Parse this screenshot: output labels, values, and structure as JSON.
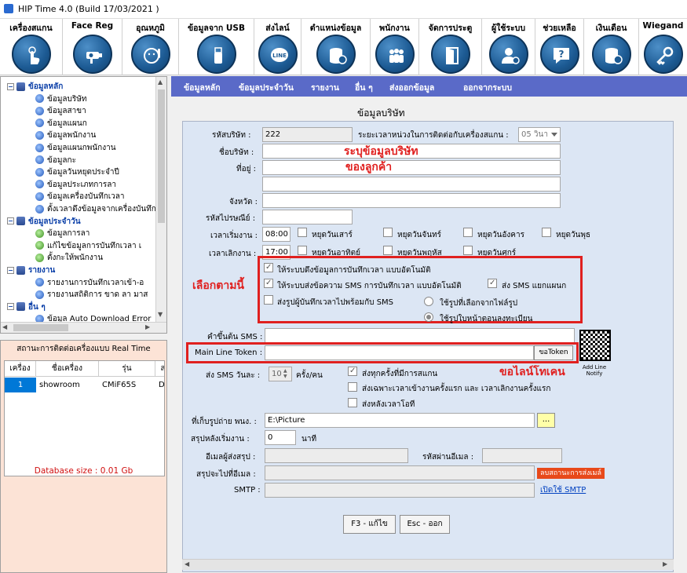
{
  "window": {
    "title": "HIP Time 4.0 (Build 17/03/2021 )"
  },
  "toolbar": [
    {
      "label": "เครื่องสแกน",
      "icon": "touch-icon"
    },
    {
      "label": "Face Reg",
      "icon": "camera-icon"
    },
    {
      "label": "อุณหภูมิ",
      "icon": "temperature-face-icon"
    },
    {
      "label": "ข้อมูลจาก USB",
      "icon": "usb-icon"
    },
    {
      "label": "ส่งไลน์",
      "icon": "line-icon"
    },
    {
      "label": "ตำแหน่งข้อมูล",
      "icon": "database-icon"
    },
    {
      "label": "พนักงาน",
      "icon": "employees-icon"
    },
    {
      "label": "จัดการประตู",
      "icon": "door-icon"
    },
    {
      "label": "ผู้ใช้ระบบ",
      "icon": "user-settings-icon"
    },
    {
      "label": "ช่วยเหลือ",
      "icon": "help-icon"
    },
    {
      "label": "เงินเดือน",
      "icon": "salary-database-icon"
    },
    {
      "label": "Wiegand",
      "icon": "key-icon"
    }
  ],
  "tree": {
    "rows": [
      {
        "label": "ข้อมูลหลัก",
        "group": true,
        "expander": "−"
      },
      {
        "label": "ข้อมูลบริษัท"
      },
      {
        "label": "ข้อมูลสาขา"
      },
      {
        "label": "ข้อมูลแผนก"
      },
      {
        "label": "ข้อมูลพนักงาน"
      },
      {
        "label": "ข้อมูลแผนกพนักงาน"
      },
      {
        "label": "ข้อมูลกะ"
      },
      {
        "label": "ข้อมูลวันหยุดประจำปี"
      },
      {
        "label": "ข้อมูลประเภทการลา"
      },
      {
        "label": "ข้อมูลเครื่องบันทึกเวลา"
      },
      {
        "label": "ตั้งเวลาดึงข้อมูลจากเครื่องบันทึก"
      },
      {
        "label": "ข้อมูลประจำวัน",
        "group": true,
        "expander": "−"
      },
      {
        "label": "ข้อมูลการลา"
      },
      {
        "label": "แก้ไขข้อมูลการบันทึกเวลา เ"
      },
      {
        "label": "ตั้งกะให้พนักงาน"
      },
      {
        "label": "รายงาน",
        "group": true,
        "expander": "−"
      },
      {
        "label": "รายงานการบันทึกเวลาเข้า-อ"
      },
      {
        "label": "รายงานสถิติการ ขาด ลา มาส"
      },
      {
        "label": "อื่น ๆ",
        "group": true,
        "expander": "−"
      },
      {
        "label": "ข้อมูล Auto Download Error"
      }
    ]
  },
  "realtime": {
    "title": "สถานะการติดต่อเครื่องแบบ Real Time",
    "columns": [
      "เครื่อง",
      "ชื่อเครื่อง",
      "รุ่น",
      "ส"
    ],
    "rows": [
      [
        "1",
        "showroom",
        "CMiF65S",
        "Dis"
      ]
    ],
    "db_size": "Database size : 0.01 Gb"
  },
  "menubar": [
    "ข้อมูลหลัก",
    "ข้อมูลประจำวัน",
    "รายงาน",
    "อื่น ๆ",
    "ส่งออกข้อมูล",
    "ออกจากระบบ"
  ],
  "form": {
    "section_title": "ข้อมูลบริษัท",
    "company_code_label": "รหัสบริษัท :",
    "company_code": "222",
    "interval_label": "ระยะเวลาหน่วงในการติดต่อกับเครื่องสแกน :",
    "interval_value": "05 วินา",
    "company_name_label": "ชื่อบริษัท :",
    "address_label": "ที่อยู่ :",
    "province_label": "จังหวัด :",
    "postcode_label": "รหัสไปรษณีย์ :",
    "work_start_label": "เวลาเริ่มงาน :",
    "work_start": "08:00",
    "work_end_label": "เวลาเลิกงาน :",
    "work_end": "17:00",
    "holidays": [
      "หยุดวันเสาร์",
      "หยุดวันจันทร์",
      "หยุดวันอังคาร",
      "หยุดวันพุธ",
      "หยุดวันอาทิตย์",
      "หยุดวันพฤหัส",
      "หยุดวันศุกร์"
    ],
    "opt_auto_pull": "ให้ระบบดึงข้อมูลการบันทึกเวลา แบบอัตโนมัติ",
    "opt_auto_sms": "ให้ระบบส่งข้อความ SMS การบันทึกเวลา แบบอัตโนมัติ",
    "opt_sms_by_dept": "ส่ง SMS แยกแผนก",
    "opt_send_photo": "ส่งรูปผู้บันทึกเวลาไปพร้อมกับ SMS",
    "radio_file_photo": "ใช้รูปที่เลือกจากไฟล์รูป",
    "radio_reg_photo": "ใช้รูปใบหน้าตอนลงทะเบียน",
    "sms_prefix_label": "คำขึ้นต้น SMS :",
    "line_token_label": "Main Line Token :",
    "line_token_button": "ขอToken",
    "add_line_notify": "Add Line Notify",
    "sms_per_day_label": "ส่ง SMS วันละ :",
    "sms_per_day": "10",
    "sms_per_person_suffix": "ครั้ง/คน",
    "sms_every_scan": "ส่งทุกครั้งที่มีการสแกน",
    "sms_first_last": "ส่งเฉพาะเวลาเข้างานครั้งแรก และ เวลาเลิกงานครั้งแรก",
    "sms_after_ot": "ส่งหลังเวลาโอที",
    "photo_store_label": "ที่เก็บรูปถ่าย พนง. :",
    "photo_store": "E:\\Picture",
    "browse_button": "...",
    "summary_after_label": "สรุปหลังเริ่มงาน :",
    "summary_after": "0",
    "minutes": "นาที",
    "sender_email_label": "อีเมลผู้ส่งสรุป :",
    "email_password_label": "รหัสผ่านอีเมล :",
    "summary_to_label": "สรุปจะไปที่อีเมล :",
    "test_send_button": "ลบสถานะการส่งเมล์",
    "smtp_label": "SMTP :",
    "smtp_link": "เปิดใช้ SMTP",
    "edit_button": "F3 - แก้ไข",
    "exit_button": "Esc - ออก"
  },
  "annotations": {
    "fill_company": "ระบุข้อมูลบริษัท",
    "of_customer": "ของลูกค้า",
    "select_this": "เลือกตามนี้",
    "request_token": "ขอไลน์โทเคน"
  },
  "colors": {
    "menubar": "#5a6ac8",
    "annotation_red": "#e0201f",
    "form_bg": "#dce6f4",
    "rt_bg": "#fce3d6"
  }
}
